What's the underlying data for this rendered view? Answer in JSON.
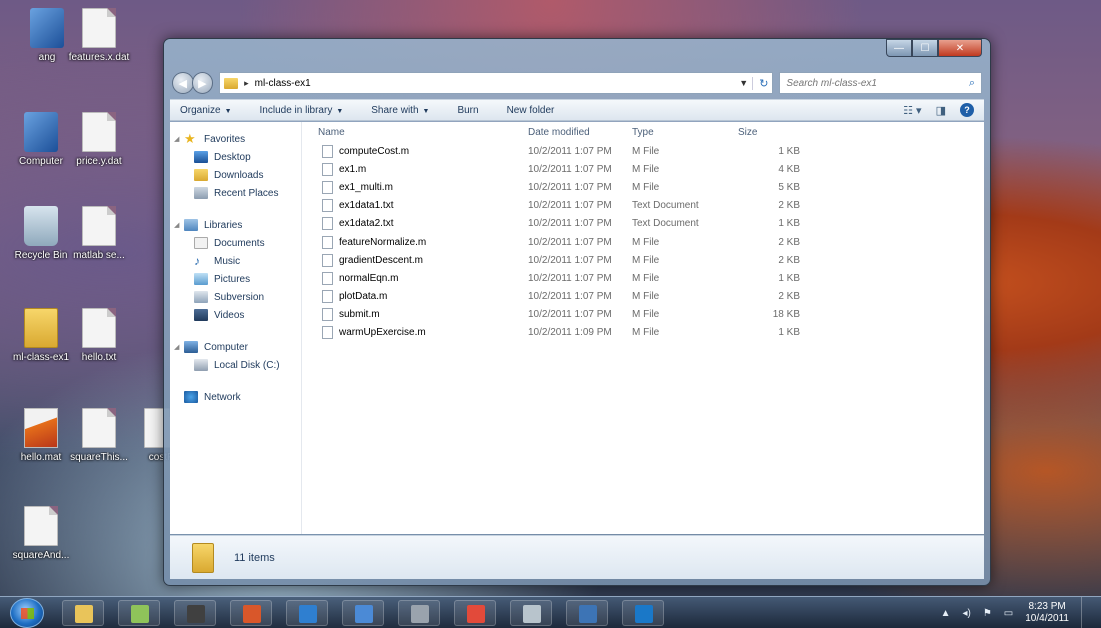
{
  "desktop": {
    "icons": [
      {
        "label": "ang",
        "kind": "exe-glyph",
        "icon": "program-icon"
      },
      {
        "label": "features.x.dat",
        "kind": "doc-glyph",
        "icon": "document-icon"
      },
      {
        "label": "Computer",
        "kind": "exe-glyph",
        "icon": "computer-icon"
      },
      {
        "label": "price.y.dat",
        "kind": "doc-glyph",
        "icon": "document-icon"
      },
      {
        "label": "Recycle Bin",
        "kind": "bin-glyph",
        "icon": "recycle-bin-icon"
      },
      {
        "label": "matlab se...",
        "kind": "doc-glyph",
        "icon": "document-icon"
      },
      {
        "label": "ml-class-ex1",
        "kind": "folder-glyph",
        "icon": "folder-icon"
      },
      {
        "label": "hello.txt",
        "kind": "doc-glyph",
        "icon": "document-icon"
      },
      {
        "label": "hello.mat",
        "kind": "matlab-glyph",
        "icon": "matlab-file-icon"
      },
      {
        "label": "squareThis...",
        "kind": "doc-glyph",
        "icon": "document-icon"
      },
      {
        "label": "costF",
        "kind": "doc-glyph",
        "icon": "document-icon"
      },
      {
        "label": "squareAnd...",
        "kind": "doc-glyph",
        "icon": "document-icon"
      }
    ]
  },
  "window": {
    "address": {
      "path": "ml-class-ex1",
      "separator": "▸"
    },
    "search": {
      "placeholder": "Search ml-class-ex1"
    },
    "toolbar": {
      "organize": "Organize",
      "include_in_library": "Include in library",
      "share_with": "Share with",
      "burn": "Burn",
      "new_folder": "New folder"
    },
    "nav": {
      "favorites": {
        "label": "Favorites",
        "items": [
          "Desktop",
          "Downloads",
          "Recent Places"
        ]
      },
      "libraries": {
        "label": "Libraries",
        "items": [
          "Documents",
          "Music",
          "Pictures",
          "Subversion",
          "Videos"
        ]
      },
      "computer": {
        "label": "Computer",
        "items": [
          "Local Disk (C:)"
        ]
      },
      "network": {
        "label": "Network"
      }
    },
    "columns": {
      "name": "Name",
      "date": "Date modified",
      "type": "Type",
      "size": "Size"
    },
    "files": [
      {
        "name": "computeCost.m",
        "date": "10/2/2011 1:07 PM",
        "type": "M File",
        "size": "1 KB"
      },
      {
        "name": "ex1.m",
        "date": "10/2/2011 1:07 PM",
        "type": "M File",
        "size": "4 KB"
      },
      {
        "name": "ex1_multi.m",
        "date": "10/2/2011 1:07 PM",
        "type": "M File",
        "size": "5 KB"
      },
      {
        "name": "ex1data1.txt",
        "date": "10/2/2011 1:07 PM",
        "type": "Text Document",
        "size": "2 KB"
      },
      {
        "name": "ex1data2.txt",
        "date": "10/2/2011 1:07 PM",
        "type": "Text Document",
        "size": "1 KB"
      },
      {
        "name": "featureNormalize.m",
        "date": "10/2/2011 1:07 PM",
        "type": "M File",
        "size": "2 KB"
      },
      {
        "name": "gradientDescent.m",
        "date": "10/2/2011 1:07 PM",
        "type": "M File",
        "size": "2 KB"
      },
      {
        "name": "normalEqn.m",
        "date": "10/2/2011 1:07 PM",
        "type": "M File",
        "size": "1 KB"
      },
      {
        "name": "plotData.m",
        "date": "10/2/2011 1:07 PM",
        "type": "M File",
        "size": "2 KB"
      },
      {
        "name": "submit.m",
        "date": "10/2/2011 1:07 PM",
        "type": "M File",
        "size": "18 KB"
      },
      {
        "name": "warmUpExercise.m",
        "date": "10/2/2011 1:09 PM",
        "type": "M File",
        "size": "1 KB"
      }
    ],
    "details": {
      "item_count": "11 items"
    }
  },
  "taskbar": {
    "apps": [
      {
        "name": "windows-explorer",
        "color": "#e9c45a"
      },
      {
        "name": "notepad-plus",
        "color": "#8fc35a"
      },
      {
        "name": "video-camera",
        "color": "#404040"
      },
      {
        "name": "powerpoint",
        "color": "#d9572a"
      },
      {
        "name": "app-tiles",
        "color": "#2f7fd0"
      },
      {
        "name": "remote-desktop",
        "color": "#4b8ad6"
      },
      {
        "name": "camera",
        "color": "#9aa3ad"
      },
      {
        "name": "chrome",
        "color": "#e24a3a"
      },
      {
        "name": "webcam",
        "color": "#b8c4cc"
      },
      {
        "name": "python",
        "color": "#3d74b5"
      },
      {
        "name": "octave",
        "color": "#1a78c8"
      }
    ],
    "clock": {
      "time": "8:23 PM",
      "date": "10/4/2011"
    }
  }
}
